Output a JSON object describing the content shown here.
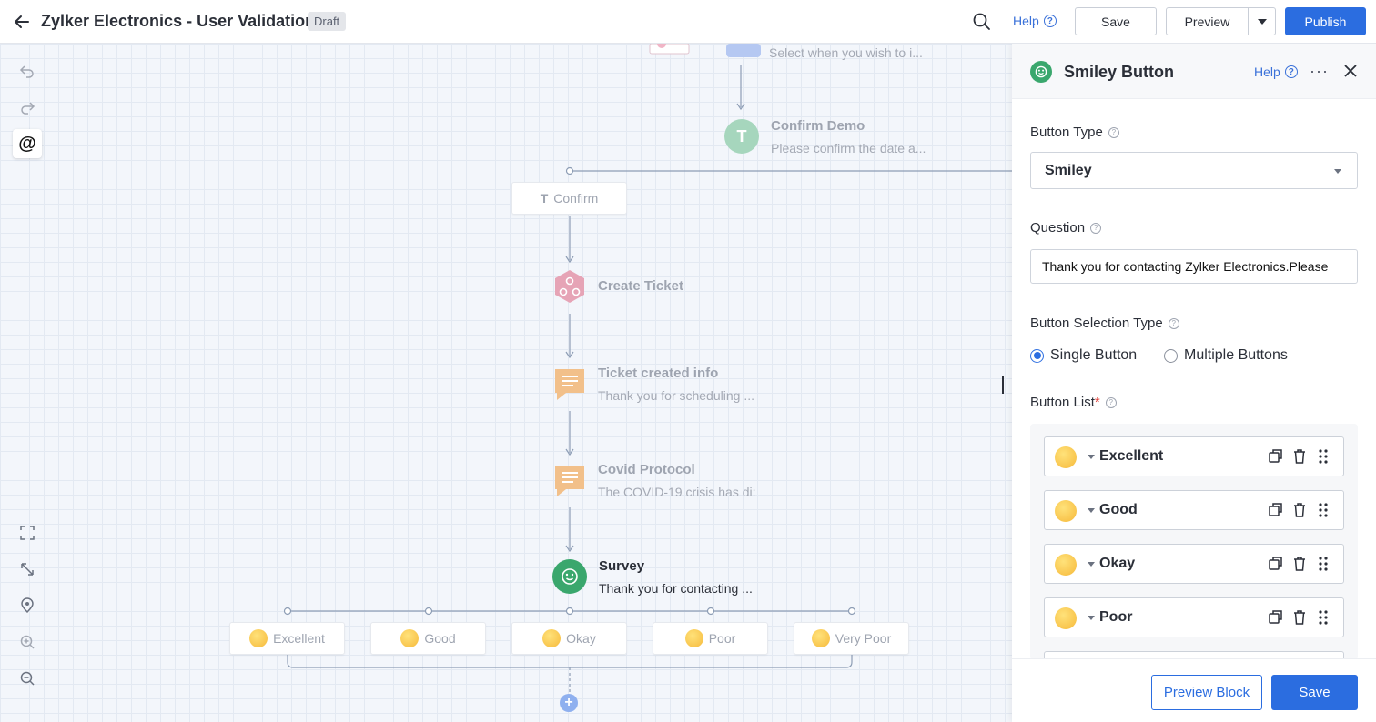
{
  "header": {
    "title": "Zylker Electronics - User Validation",
    "status_badge": "Draft",
    "help_label": "Help",
    "save_label": "Save",
    "preview_label": "Preview",
    "publish_label": "Publish"
  },
  "canvas": {
    "nodes": {
      "top": {
        "subtitle": "Select when you wish to i..."
      },
      "confirm_demo": {
        "title": "Confirm Demo",
        "subtitle": "Please confirm the date a..."
      },
      "confirm_option": {
        "label": "Confirm"
      },
      "create_ticket": {
        "title": "Create Ticket"
      },
      "ticket_created": {
        "title": "Ticket created info",
        "subtitle": "Thank you for scheduling ..."
      },
      "covid": {
        "title": "Covid Protocol",
        "subtitle": "The COVID-19 crisis has di:"
      },
      "survey": {
        "title": "Survey",
        "subtitle": "Thank you for contacting ..."
      }
    },
    "survey_options": [
      "Excellent",
      "Good",
      "Okay",
      "Poor",
      "Very Poor"
    ]
  },
  "panel": {
    "title": "Smiley Button",
    "help_label": "Help",
    "button_type": {
      "label": "Button Type",
      "value": "Smiley"
    },
    "question": {
      "label": "Question",
      "value": "Thank you for contacting Zylker Electronics.Please"
    },
    "selection_type": {
      "label": "Button Selection Type",
      "options": [
        "Single Button",
        "Multiple Buttons"
      ],
      "selected": "Single Button"
    },
    "button_list": {
      "label": "Button List",
      "required_mark": "*",
      "items": [
        "Excellent",
        "Good",
        "Okay",
        "Poor"
      ]
    },
    "footer": {
      "preview_label": "Preview Block",
      "save_label": "Save"
    }
  },
  "colors": {
    "accent": "#2b6de0",
    "survey_node": "#3aa76d",
    "webhook_node": "#e39aae",
    "message_node": "#f0b060"
  }
}
